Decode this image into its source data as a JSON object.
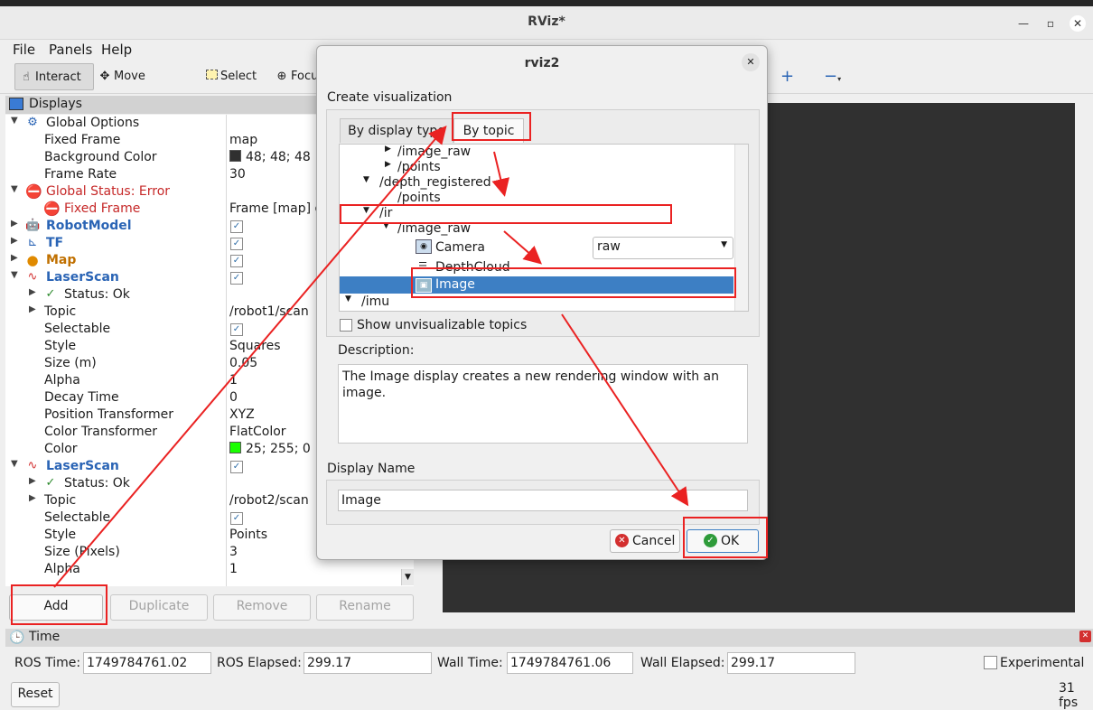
{
  "window": {
    "title": "RViz*"
  },
  "menu": [
    "File",
    "Panels",
    "Help"
  ],
  "toolbar": {
    "interact": "Interact",
    "move_camera": "Move Camera",
    "select": "Select",
    "focus": "Focus"
  },
  "displays_panel": {
    "title": "Displays",
    "rows": [
      {
        "label": "Global Options",
        "value": ""
      },
      {
        "label": "Fixed Frame",
        "value": "map"
      },
      {
        "label": "Background Color",
        "value": "48; 48; 48"
      },
      {
        "label": "Frame Rate",
        "value": "30"
      },
      {
        "label": "Global Status: Error",
        "value": ""
      },
      {
        "label": "Fixed Frame",
        "value": "Frame [map] d"
      },
      {
        "label": "RobotModel",
        "value": ""
      },
      {
        "label": "TF",
        "value": ""
      },
      {
        "label": "Map",
        "value": ""
      },
      {
        "label": "LaserScan",
        "value": ""
      },
      {
        "label": "Status: Ok",
        "value": ""
      },
      {
        "label": "Topic",
        "value": "/robot1/scan"
      },
      {
        "label": "Selectable",
        "value": ""
      },
      {
        "label": "Style",
        "value": "Squares"
      },
      {
        "label": "Size (m)",
        "value": "0.05"
      },
      {
        "label": "Alpha",
        "value": "1"
      },
      {
        "label": "Decay Time",
        "value": "0"
      },
      {
        "label": "Position Transformer",
        "value": "XYZ"
      },
      {
        "label": "Color Transformer",
        "value": "FlatColor"
      },
      {
        "label": "Color",
        "value": "25; 255; 0"
      },
      {
        "label": "LaserScan",
        "value": ""
      },
      {
        "label": "Status: Ok",
        "value": ""
      },
      {
        "label": "Topic",
        "value": "/robot2/scan"
      },
      {
        "label": "Selectable",
        "value": ""
      },
      {
        "label": "Style",
        "value": "Points"
      },
      {
        "label": "Size (Pixels)",
        "value": "3"
      },
      {
        "label": "Alpha",
        "value": "1"
      }
    ],
    "buttons": {
      "add": "Add",
      "duplicate": "Duplicate",
      "remove": "Remove",
      "rename": "Rename"
    },
    "colors": {
      "background": "#303030",
      "laser": "#19ff00",
      "error": "#c62828",
      "link": "#2a64b5"
    }
  },
  "time_panel": {
    "title": "Time",
    "ros_time_label": "ROS Time:",
    "ros_time": "1749784761.02",
    "ros_elapsed_label": "ROS Elapsed:",
    "ros_elapsed": "299.17",
    "wall_time_label": "Wall Time:",
    "wall_time": "1749784761.06",
    "wall_elapsed_label": "Wall Elapsed:",
    "wall_elapsed": "299.17",
    "experimental": "Experimental",
    "reset": "Reset",
    "fps": "31 fps"
  },
  "dialog": {
    "title": "rviz2",
    "section": "Create visualization",
    "tab_by_type": "By display type",
    "tab_by_topic": "By topic",
    "topics": {
      "t1": "/image_raw",
      "t2": "/points",
      "t3": "/depth_registered",
      "t4": "/points",
      "t5": "/ir",
      "t6": "/image_raw",
      "t7": "Camera",
      "t7_select": "raw",
      "t8": "DepthCloud",
      "t9": "Image",
      "t10": "/imu"
    },
    "show_unvisualizable": "Show unvisualizable topics",
    "description_label": "Description:",
    "description": "The Image display creates a new rendering window with an image.",
    "display_name_label": "Display Name",
    "display_name": "Image",
    "cancel": "Cancel",
    "ok": "OK",
    "highlight_color": "#ea2222",
    "selection_color": "#3d7fc4"
  }
}
